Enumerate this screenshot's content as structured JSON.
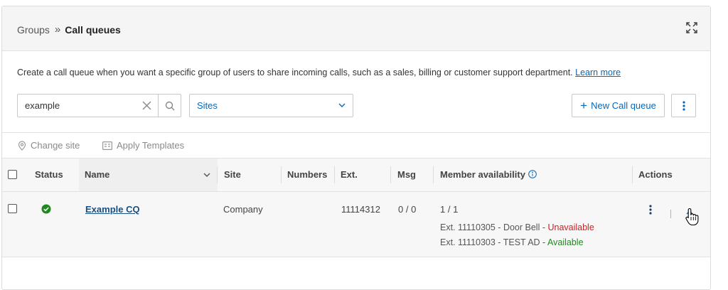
{
  "breadcrumb": {
    "parent": "Groups",
    "separator": "»",
    "current": "Call queues"
  },
  "description": {
    "text": "Create a call queue when you want a specific group of users to share incoming calls, such as a sales, billing or customer support department.",
    "link": "Learn more"
  },
  "search": {
    "value": "example",
    "placeholder": ""
  },
  "sites_filter": {
    "selected": "Sites"
  },
  "buttons": {
    "new_call_queue": "New Call queue",
    "new_icon": "plus"
  },
  "toolbar": {
    "change_site": "Change site",
    "apply_templates": "Apply Templates"
  },
  "table": {
    "columns": {
      "status": "Status",
      "name": "Name",
      "site": "Site",
      "numbers": "Numbers",
      "ext": "Ext.",
      "msg": "Msg",
      "member_availability": "Member availability",
      "actions": "Actions"
    },
    "rows": [
      {
        "status": "active",
        "name": "Example CQ",
        "site": "Company",
        "numbers": "",
        "ext": "11114312",
        "msg": "0 / 0",
        "member_count": "1 / 1",
        "members": [
          {
            "label": "Ext. 11110305 - Door Bell - ",
            "status": "Unavailable"
          },
          {
            "label": "Ext. 11110303 - TEST AD - ",
            "status": "Available"
          }
        ]
      }
    ]
  },
  "colors": {
    "accent": "#0a67b3",
    "available": "#1e8a1e",
    "unavailable": "#cc2222",
    "status_ok": "#1e8a1e"
  }
}
